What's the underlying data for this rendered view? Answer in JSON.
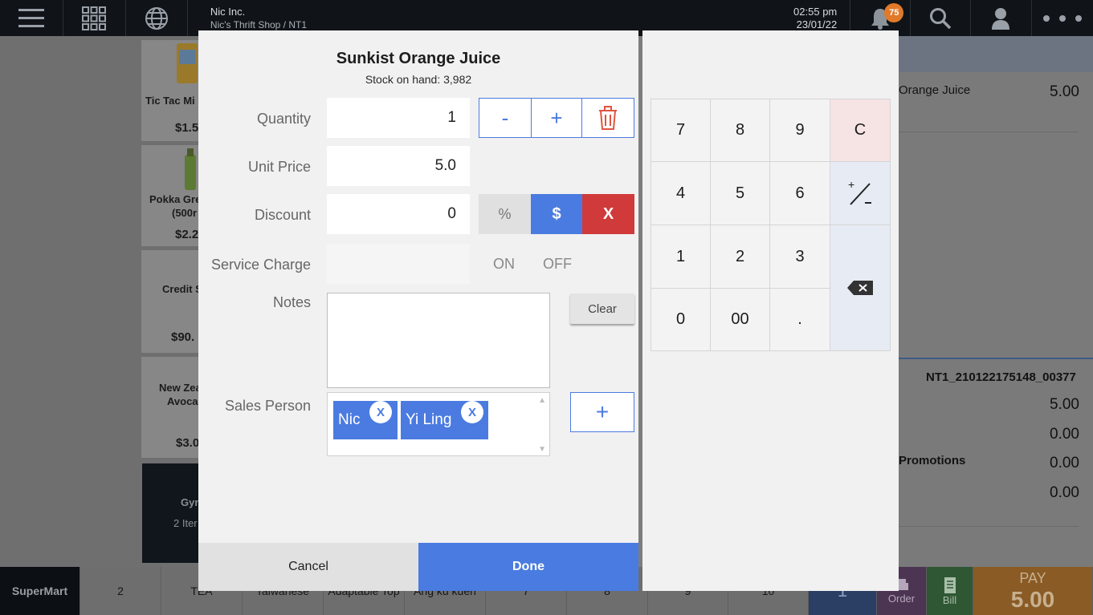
{
  "topbar": {
    "company": "Nic Inc.",
    "store": "Nic's Thrift Shop / NT1",
    "time": "02:55 pm",
    "date": "23/01/22",
    "notifications": "75",
    "icons": [
      "menu-icon",
      "apps-grid-icon",
      "globe-icon",
      "bell-icon",
      "search-icon",
      "user-icon",
      "more-icon"
    ]
  },
  "background": {
    "tiles": [
      {
        "name": "Tic Tac Mi",
        "price": "$1.5"
      },
      {
        "name": "Pokka Gre",
        "name2": "(500r",
        "price": "$2.2"
      },
      {
        "name": "Credit S",
        "price": "$90."
      },
      {
        "name": "New Zea",
        "name2": "Avoca",
        "price": "$3.0"
      }
    ],
    "dark_tile": {
      "name": "Gym",
      "count": "2 Iter"
    },
    "order_item": {
      "name": "Orange Juice",
      "price": "5.00"
    },
    "order_id": "NT1_210122175148_00377",
    "totals": [
      "5.00",
      "0.00",
      "0.00",
      "0.00"
    ],
    "promotions_label": "Promotions"
  },
  "bottombar": {
    "brand": "SuperMart",
    "tabs": [
      "2",
      "TEA",
      "Taiwanese",
      "Adaptable Top",
      "Ang ku kueh",
      "7",
      "8",
      "9",
      "10"
    ],
    "blue": "1",
    "order": "Order",
    "bill": "Bill",
    "pay_label": "PAY",
    "pay_value": "5.00"
  },
  "dialog": {
    "title": "Sunkist Orange Juice",
    "stock": "Stock on hand: 3,982",
    "quantity_label": "Quantity",
    "quantity_value": "1",
    "minus": "-",
    "plus": "+",
    "unit_price_label": "Unit Price",
    "unit_price_value": "5.0",
    "discount_label": "Discount",
    "discount_value": "0",
    "percent": "%",
    "dollar": "$",
    "remove": "X",
    "service_charge_label": "Service Charge",
    "on": "ON",
    "off": "OFF",
    "notes_label": "Notes",
    "clear": "Clear",
    "sales_person_label": "Sales Person",
    "sales_people": [
      "Nic",
      "Yi Ling"
    ],
    "chip_remove": "X",
    "add": "+",
    "cancel": "Cancel",
    "done": "Done",
    "accent": "#4a7be0",
    "danger": "#d03a3a"
  },
  "keypad": {
    "keys": [
      "7",
      "8",
      "9",
      "C",
      "4",
      "5",
      "6",
      "1",
      "2",
      "3",
      "0",
      "00",
      "."
    ]
  }
}
